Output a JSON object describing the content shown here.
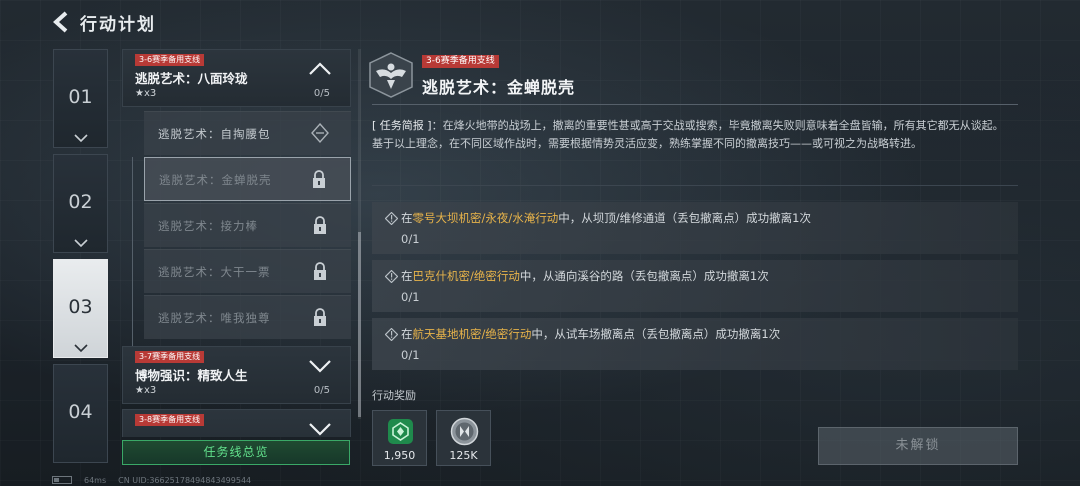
{
  "header": {
    "title": "行动计划"
  },
  "season_tabs": [
    "01",
    "02",
    "03",
    "04"
  ],
  "task_list": {
    "groups": [
      {
        "badge": "3-6赛季备用支线",
        "title": "逃脱艺术：八面玲珑",
        "stars": "★x3",
        "progress": "0/5",
        "expanded": true,
        "items": [
          {
            "label": "逃脱艺术：自掏腰包",
            "state": "available"
          },
          {
            "label": "逃脱艺术：金蝉脱壳",
            "state": "locked",
            "selected": true
          },
          {
            "label": "逃脱艺术：接力棒",
            "state": "locked"
          },
          {
            "label": "逃脱艺术：大干一票",
            "state": "locked"
          },
          {
            "label": "逃脱艺术：唯我独尊",
            "state": "locked"
          }
        ]
      },
      {
        "badge": "3-7赛季备用支线",
        "title": "博物强识：精致人生",
        "stars": "★x3",
        "progress": "0/5",
        "expanded": false
      },
      {
        "badge": "3-8赛季备用支线",
        "title": "",
        "stars": "",
        "progress": "",
        "expanded": false
      }
    ],
    "overview_button": "任务线总览"
  },
  "detail": {
    "badge": "3-6赛季备用支线",
    "title": "逃脱艺术：金蝉脱壳",
    "brief_tag": "[ 任务简报 ]",
    "brief_text": "：在烽火地带的战场上，撤离的重要性甚或高于交战或搜索，毕竟撤离失败则意味着全盘皆输，所有其它都无从谈起。",
    "brief_text2": "基于以上理念，在不同区域作战时，需要根据情势灵活应变，熟练掌握不同的撤离技巧——或可视之为战略转进。",
    "objectives": [
      {
        "prefix": "在",
        "highlight": "零号大坝机密/永夜/水淹行动",
        "suffix": "中，从坝顶/维修通道（丢包撤离点）成功撤离1次",
        "progress": "0/1"
      },
      {
        "prefix": "在",
        "highlight": "巴克什机密/绝密行动",
        "suffix": "中，从通向溪谷的路（丢包撤离点）成功撤离1次",
        "progress": "0/1"
      },
      {
        "prefix": "在",
        "highlight": "航天基地机密/绝密行动",
        "suffix": "中，从试车场撤离点（丢包撤离点）成功撤离1次",
        "progress": "0/1"
      }
    ],
    "reward_label": "行动奖励",
    "rewards": [
      {
        "amount": "1,950",
        "icon": "exp-badge-icon"
      },
      {
        "amount": "125K",
        "icon": "coin-icon"
      }
    ],
    "unlock_button": "未解锁"
  },
  "footer": {
    "ping": "64ms",
    "uid": "CN UID:36625178494843499544"
  },
  "colors": {
    "accent_green": "#62e08c",
    "highlight_gold": "#e7b34a",
    "badge_red": "#b83a36"
  }
}
